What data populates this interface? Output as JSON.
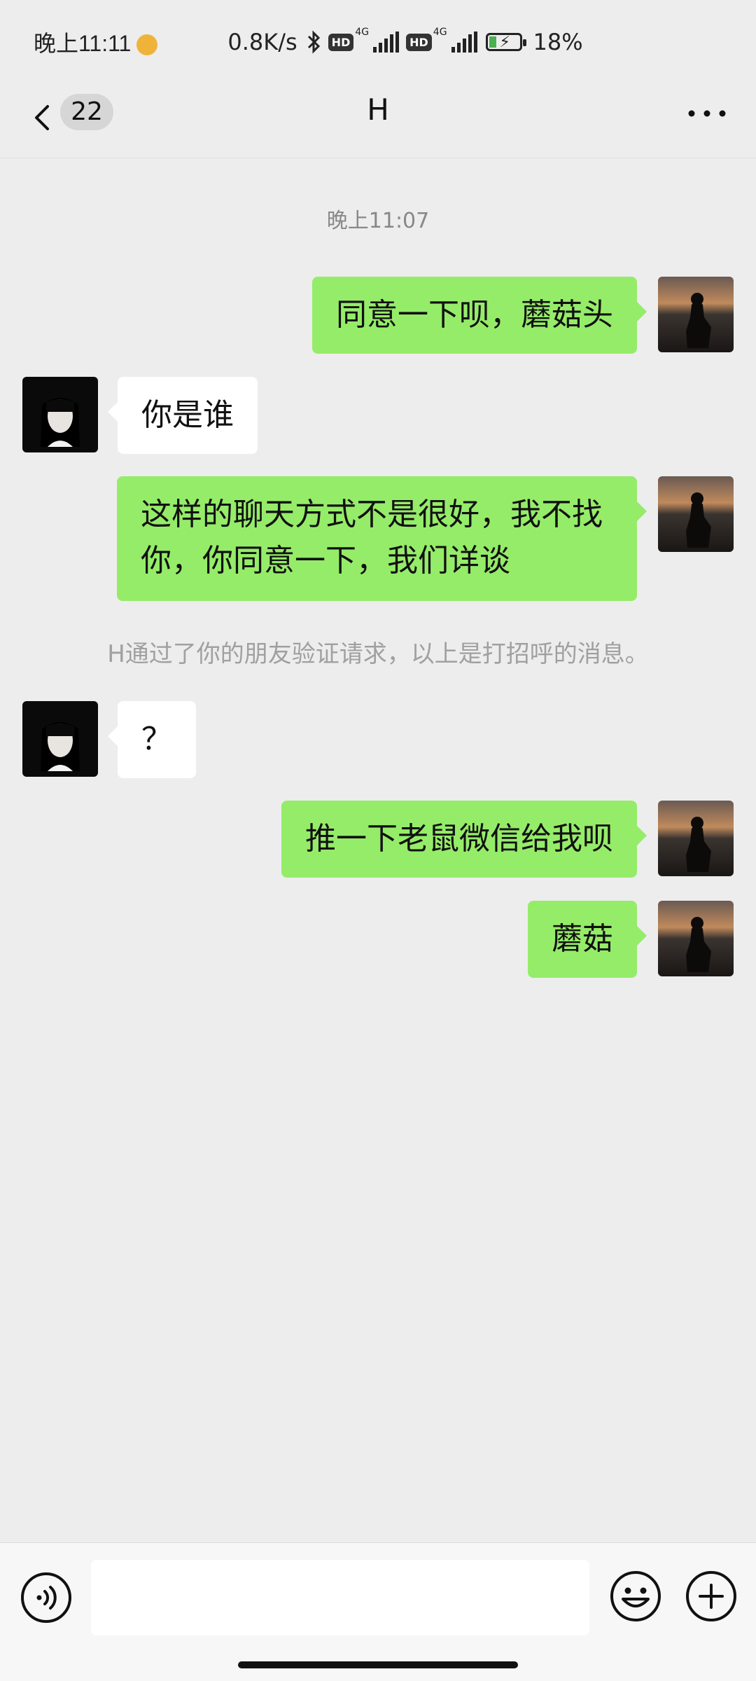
{
  "status_bar": {
    "time": "晚上11:11",
    "net_speed": "0.8K/s",
    "sim1_label": "HD",
    "sim1_net": "4G",
    "sim2_label": "HD",
    "sim2_net": "4G",
    "battery": "18%",
    "battery_level": 0.18,
    "icons": [
      "app-badge-icon",
      "bluetooth-icon",
      "signal-icon",
      "battery-charging-icon"
    ]
  },
  "nav": {
    "unread_count": "22",
    "title": "H",
    "icons": [
      "back-arrow-icon",
      "more-icon"
    ]
  },
  "chat": {
    "timestamp": "晚上11:07",
    "messages": [
      {
        "from": "me",
        "text": "同意一下呗，蘑菇头"
      },
      {
        "from": "her",
        "text": "你是谁"
      },
      {
        "from": "me",
        "text": "这样的聊天方式不是很好，我不找\n你，你同意一下，我们详谈"
      },
      {
        "from": "her",
        "text": "？"
      },
      {
        "from": "me",
        "text": "推一下老鼠微信给我呗"
      },
      {
        "from": "me",
        "text": "蘑菇"
      }
    ],
    "system_note": "H通过了你的朋友验证请求，以上是打招呼的消息。"
  },
  "input_bar": {
    "input_value": "",
    "icons": [
      "voice-icon",
      "emoji-icon",
      "plus-icon"
    ]
  },
  "colors": {
    "background": "#ededed",
    "my_bubble": "#95ec69",
    "her_bubble": "#ffffff",
    "system_text": "#a0a0a0"
  }
}
